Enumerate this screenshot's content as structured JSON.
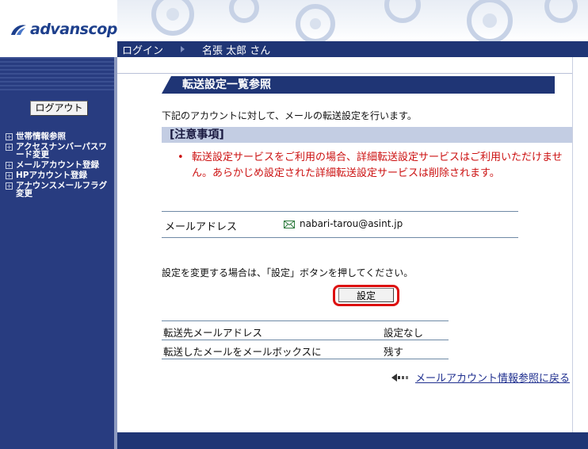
{
  "brand": {
    "logo_text": "advanscope"
  },
  "topbar": {
    "login_label": "ログイン",
    "user_label": "名張 太郎 さん"
  },
  "sidebar": {
    "logout_label": "ログアウト",
    "menu": [
      "世帯情報参照",
      "アクセスナンバーパスワード変更",
      "メールアカウント登録",
      "HPアカウント登録",
      "アナウンスメールフラグ変更"
    ]
  },
  "main": {
    "title": "転送設定一覧参照",
    "intro": "下記のアカウントに対して、メールの転送設定を行います。",
    "notice_title": "[注意事項]",
    "notice_text": "転送設定サービスをご利用の場合、詳細転送設定サービスはご利用いただけません。あらかじめ設定された詳細転送設定サービスは削除されます。",
    "mail_label": "メールアドレス",
    "mail_value": "nabari-tarou@asint.jp",
    "instruction": "設定を変更する場合は、「設定」ボタンを押してください。",
    "set_button": "設定",
    "rows": [
      {
        "key": "転送先メールアドレス",
        "value": "設定なし"
      },
      {
        "key": "転送したメールをメールボックスに",
        "value": "残す"
      }
    ],
    "back_link": "メールアカウント情報参照に戻る"
  },
  "colors": {
    "nav": "#1f3575",
    "sidebar": "#283c80",
    "notice": "#cc1111",
    "highlight": "#dd1111"
  }
}
